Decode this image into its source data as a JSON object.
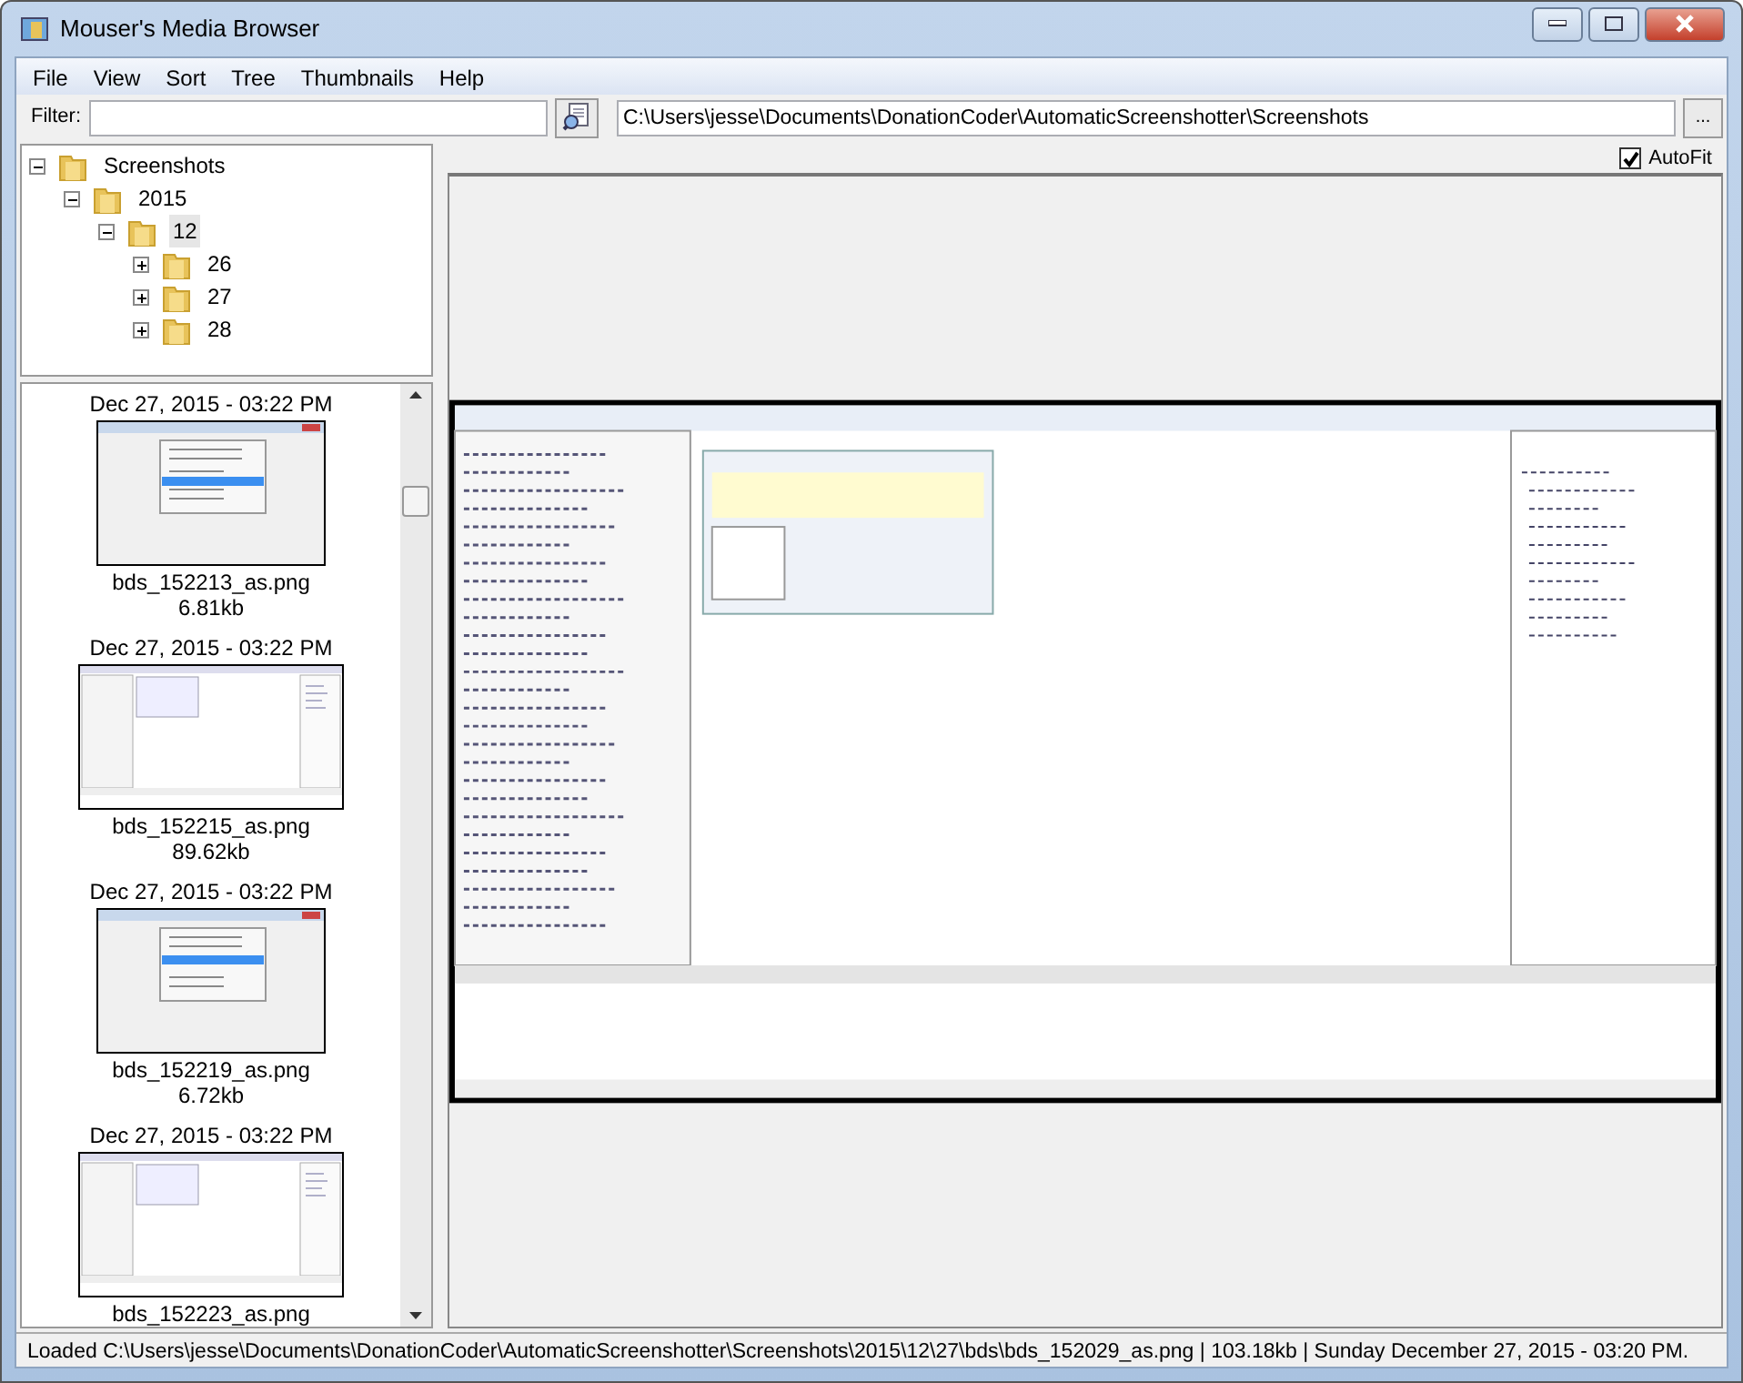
{
  "window": {
    "title": "Mouser's Media Browser"
  },
  "menu": [
    "File",
    "View",
    "Sort",
    "Tree",
    "Thumbnails",
    "Help"
  ],
  "filter": {
    "label": "Filter:"
  },
  "path": {
    "value": "C:\\Users\\jesse\\Documents\\DonationCoder\\AutomaticScreenshotter\\Screenshots",
    "browse_label": "..."
  },
  "autofit": {
    "label": "AutoFit",
    "checked": true
  },
  "tree": [
    {
      "label": "Screenshots",
      "expanded": true,
      "selected": false,
      "children": [
        {
          "label": "2015",
          "expanded": true,
          "selected": false,
          "children": [
            {
              "label": "12",
              "expanded": true,
              "selected": true,
              "children": [
                {
                  "label": "26",
                  "expanded": false,
                  "selected": false
                },
                {
                  "label": "27",
                  "expanded": false,
                  "selected": false
                },
                {
                  "label": "28",
                  "expanded": false,
                  "selected": false
                }
              ]
            }
          ]
        }
      ]
    }
  ],
  "thumbnails": [
    {
      "date": "Dec 27, 2015 - 03:22 PM",
      "kind": "menu",
      "filename": "bds_152213_as.png",
      "size": "6.81kb"
    },
    {
      "date": "Dec 27, 2015 - 03:22 PM",
      "kind": "window",
      "filename": "bds_152215_as.png",
      "size": "89.62kb"
    },
    {
      "date": "Dec 27, 2015 - 03:22 PM",
      "kind": "menu",
      "filename": "bds_152219_as.png",
      "size": "6.72kb"
    },
    {
      "date": "Dec 27, 2015 - 03:22 PM",
      "kind": "window",
      "filename": "bds_152223_as.png"
    }
  ],
  "status_bar": "Loaded C:\\Users\\jesse\\Documents\\DonationCoder\\AutomaticScreenshotter\\Screenshots\\2015\\12\\27\\bds\\bds_152029_as.png | 103.18kb | Sunday December 27, 2015 - 03:20 PM."
}
